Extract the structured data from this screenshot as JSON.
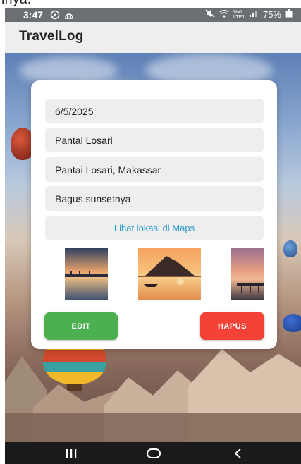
{
  "status_bar": {
    "time": "3:47",
    "battery": "75%",
    "network_label": "Vo0 LTE1"
  },
  "app": {
    "title": "TravelLog"
  },
  "entry": {
    "date": "6/5/2025",
    "place_name": "Pantai Losari",
    "location": "Pantai Losari, Makassar",
    "note": "Bagus sunsetnya",
    "maps_link": "Lihat lokasi di Maps",
    "photos": [
      "sunset-pier-photo",
      "sunset-mountain-boat-photo",
      "sunset-pier-narrow-photo"
    ]
  },
  "actions": {
    "edit_label": "EDIT",
    "delete_label": "HAPUS"
  },
  "colors": {
    "edit_button": "#4caf50",
    "delete_button": "#f44336",
    "link": "#2a9bd0",
    "field_bg": "#eeeeee",
    "app_bar_bg": "#eeeeee",
    "status_bar_bg": "#6b6e73"
  },
  "icons": [
    "whatsapp-icon",
    "cast-icon",
    "mute-icon",
    "wifi-icon",
    "signal-icon",
    "battery-icon",
    "recents-icon",
    "home-icon",
    "back-icon"
  ]
}
